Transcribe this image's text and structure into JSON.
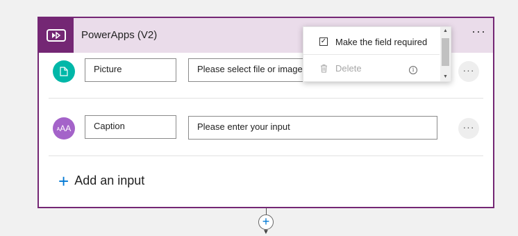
{
  "card": {
    "title": "PowerApps (V2)",
    "more": "···",
    "accent": "#742774",
    "header_bg": "#eadcea"
  },
  "inputs": [
    {
      "icon": "file-icon",
      "icon_color": "#00b7a8",
      "name": "Picture",
      "placeholder": "Please select file or image",
      "more": "···"
    },
    {
      "icon": "text-icon",
      "icon_color": "#a463c9",
      "icon_text": "AA",
      "name": "Caption",
      "placeholder": "Please enter your input",
      "more": "···"
    }
  ],
  "add_input": {
    "plus": "+",
    "label": "Add an input",
    "color": "#0078d4"
  },
  "menu": {
    "required_label": "Make the field required",
    "required_checked": true,
    "delete_label": "Delete"
  },
  "connector": {
    "plus": "+"
  }
}
